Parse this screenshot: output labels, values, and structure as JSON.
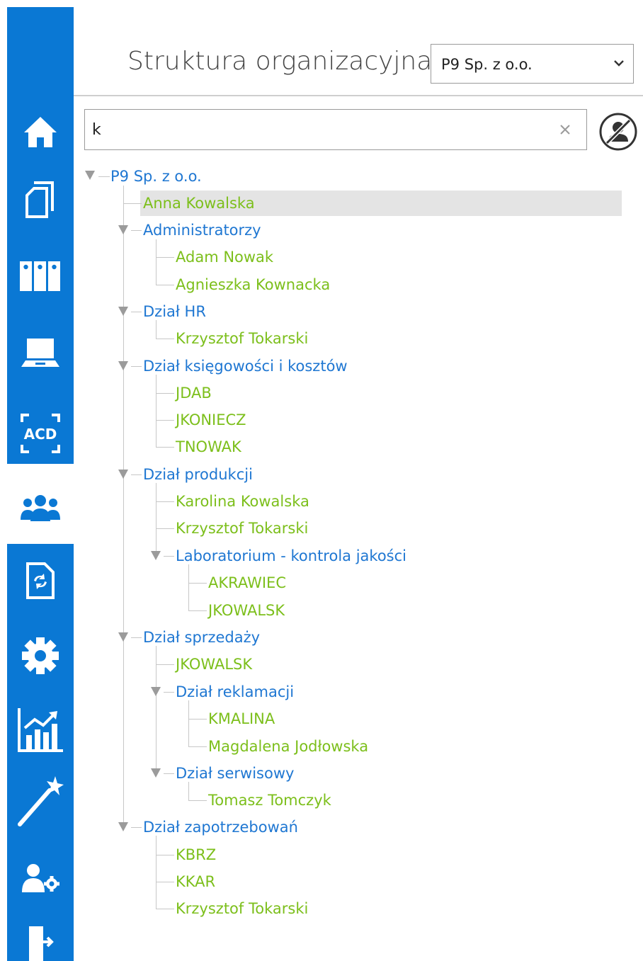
{
  "header": {
    "title": "Struktura organizacyjna",
    "company_select": {
      "value": "P9 Sp. z o.o."
    }
  },
  "sidebar": {
    "items": [
      {
        "icon": "home-icon"
      },
      {
        "icon": "documents-icon"
      },
      {
        "icon": "binders-icon"
      },
      {
        "icon": "laptop-icon"
      },
      {
        "icon": "acd-icon",
        "label": "ACD"
      },
      {
        "icon": "users-group-icon",
        "active": true
      },
      {
        "icon": "workflow-document-icon"
      },
      {
        "icon": "gear-icon"
      },
      {
        "icon": "chart-icon"
      },
      {
        "icon": "magic-wand-icon"
      },
      {
        "icon": "user-settings-icon"
      },
      {
        "icon": "logout-door-icon"
      }
    ]
  },
  "search": {
    "value": "k",
    "placeholder": ""
  },
  "tree": {
    "root": "P9 Sp. z o.o.",
    "rows": [
      {
        "text": "Anna Kowalska",
        "type": "person",
        "selected": true
      },
      {
        "text": "Administratorzy",
        "type": "org"
      },
      {
        "text": "Adam Nowak",
        "type": "person"
      },
      {
        "text": "Agnieszka Kownacka",
        "type": "person"
      },
      {
        "text": "Dział HR",
        "type": "org"
      },
      {
        "text": "Krzysztof Tokarski",
        "type": "person"
      },
      {
        "text": "Dział księgowości i kosztów",
        "type": "org"
      },
      {
        "text": "JDAB",
        "type": "person"
      },
      {
        "text": "JKONIECZ",
        "type": "person"
      },
      {
        "text": "TNOWAK",
        "type": "person"
      },
      {
        "text": "Dział produkcji",
        "type": "org"
      },
      {
        "text": "Karolina Kowalska",
        "type": "person"
      },
      {
        "text": "Krzysztof Tokarski",
        "type": "person"
      },
      {
        "text": "Laboratorium - kontrola jakości",
        "type": "org"
      },
      {
        "text": "AKRAWIEC",
        "type": "person"
      },
      {
        "text": "JKOWALSK",
        "type": "person"
      },
      {
        "text": "Dział sprzedaży",
        "type": "org"
      },
      {
        "text": "JKOWALSK",
        "type": "person"
      },
      {
        "text": "Dział reklamacji",
        "type": "org"
      },
      {
        "text": "KMALINA",
        "type": "person"
      },
      {
        "text": "Magdalena Jodłowska",
        "type": "person"
      },
      {
        "text": "Dział serwisowy",
        "type": "org"
      },
      {
        "text": "Tomasz Tomczyk",
        "type": "person"
      },
      {
        "text": "Dział zapotrzebowań",
        "type": "org"
      },
      {
        "text": "KBRZ",
        "type": "person"
      },
      {
        "text": "KKAR",
        "type": "person"
      },
      {
        "text": "Krzysztof Tokarski",
        "type": "person"
      }
    ]
  },
  "colors": {
    "sidebar": "#0a78d4",
    "org_node": "#1f77d2",
    "person_node": "#7cbf1b",
    "selection": "#e4e4e4"
  }
}
